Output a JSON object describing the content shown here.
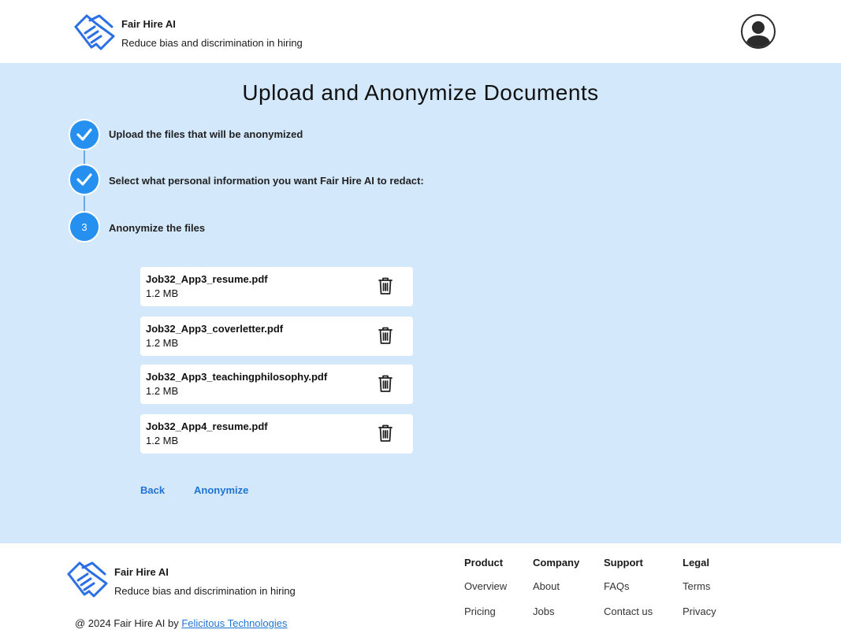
{
  "header": {
    "brand_name": "Fair Hire AI",
    "tagline": "Reduce bias and discrimination in hiring"
  },
  "main": {
    "title": "Upload and Anonymize Documents",
    "steps": [
      {
        "label": "Upload the files that will be anonymized",
        "status": "complete"
      },
      {
        "label": "Select what personal information you want Fair Hire AI to redact:",
        "status": "complete"
      },
      {
        "label": "Anonymize the files",
        "status": "active",
        "number": "3"
      }
    ],
    "files": [
      {
        "name": "Job32_App3_resume.pdf",
        "size": "1.2 MB"
      },
      {
        "name": "Job32_App3_coverletter.pdf",
        "size": "1.2 MB"
      },
      {
        "name": "Job32_App3_teachingphilosophy.pdf",
        "size": "1.2 MB"
      },
      {
        "name": "Job32_App4_resume.pdf",
        "size": "1.2 MB"
      }
    ],
    "back_label": "Back",
    "anonymize_label": "Anonymize"
  },
  "footer": {
    "brand_name": "Fair Hire AI",
    "tagline": "Reduce bias and discrimination in hiring",
    "columns": [
      {
        "title": "Product",
        "links": [
          "Overview",
          "Pricing"
        ]
      },
      {
        "title": "Company",
        "links": [
          "About",
          "Jobs"
        ]
      },
      {
        "title": "Support",
        "links": [
          "FAQs",
          "Contact us"
        ]
      },
      {
        "title": "Legal",
        "links": [
          "Terms",
          "Privacy"
        ]
      }
    ],
    "copyright_prefix": "@ 2024 Fair Hire AI by",
    "copyright_link": "Felicitous Technologies"
  },
  "colors": {
    "accent": "#2590f0",
    "main_bg": "#d3e8fb",
    "link": "#1f74d4"
  },
  "icons": {
    "logo": "handshake-logo-icon",
    "avatar": "user-avatar-icon",
    "check": "check-icon",
    "delete": "trash-icon"
  }
}
